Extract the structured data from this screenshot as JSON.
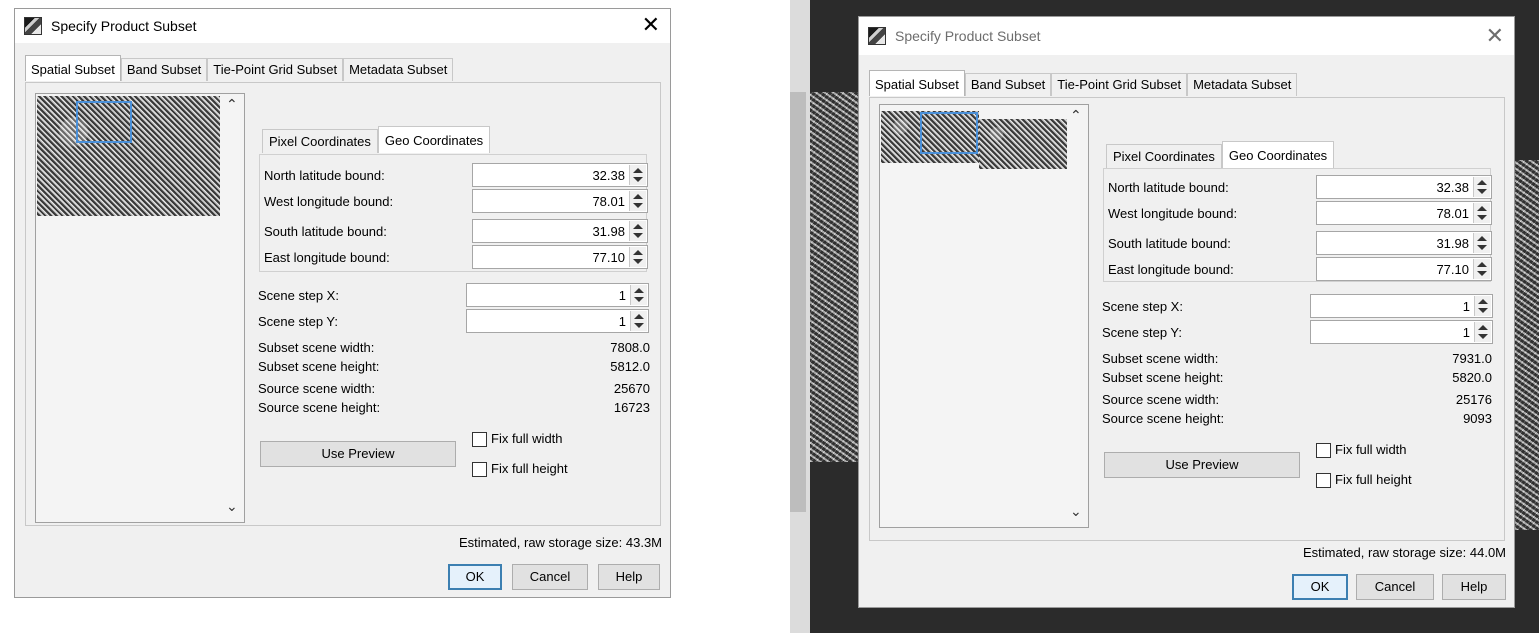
{
  "dialogs": [
    {
      "title": "Specify Product Subset",
      "close_glyph": "✕",
      "tabs": [
        "Spatial Subset",
        "Band Subset",
        "Tie-Point Grid Subset",
        "Metadata Subset"
      ],
      "subtabs": [
        "Pixel Coordinates",
        "Geo Coordinates"
      ],
      "fields": [
        {
          "label": "North latitude bound:",
          "value": "32.38"
        },
        {
          "label": "West longitude bound:",
          "value": "78.01"
        },
        {
          "label": "South latitude bound:",
          "value": "31.98"
        },
        {
          "label": "East longitude bound:",
          "value": "77.10"
        }
      ],
      "steps": [
        {
          "label": "Scene step X:",
          "value": "1"
        },
        {
          "label": "Scene step Y:",
          "value": "1"
        }
      ],
      "info": [
        {
          "label": "Subset scene width:",
          "value": "7808.0"
        },
        {
          "label": "Subset scene height:",
          "value": "5812.0"
        },
        {
          "label": "Source scene width:",
          "value": "25670"
        },
        {
          "label": "Source scene height:",
          "value": "16723"
        }
      ],
      "use_preview": "Use Preview",
      "fix_full_width": "Fix full width",
      "fix_full_height": "Fix full height",
      "storage": "Estimated, raw storage size: 43.3M",
      "ok": "OK",
      "cancel": "Cancel",
      "help": "Help"
    },
    {
      "title": "Specify Product Subset",
      "close_glyph": "✕",
      "tabs": [
        "Spatial Subset",
        "Band Subset",
        "Tie-Point Grid Subset",
        "Metadata Subset"
      ],
      "subtabs": [
        "Pixel Coordinates",
        "Geo Coordinates"
      ],
      "fields": [
        {
          "label": "North latitude bound:",
          "value": "32.38"
        },
        {
          "label": "West longitude bound:",
          "value": "78.01"
        },
        {
          "label": "South latitude bound:",
          "value": "31.98"
        },
        {
          "label": "East longitude bound:",
          "value": "77.10"
        }
      ],
      "steps": [
        {
          "label": "Scene step X:",
          "value": "1"
        },
        {
          "label": "Scene step Y:",
          "value": "1"
        }
      ],
      "info": [
        {
          "label": "Subset scene width:",
          "value": "7931.0"
        },
        {
          "label": "Subset scene height:",
          "value": "5820.0"
        },
        {
          "label": "Source scene width:",
          "value": "25176"
        },
        {
          "label": "Source scene height:",
          "value": "9093"
        }
      ],
      "use_preview": "Use Preview",
      "fix_full_width": "Fix full width",
      "fix_full_height": "Fix full height",
      "storage": "Estimated, raw storage size: 44.0M",
      "ok": "OK",
      "cancel": "Cancel",
      "help": "Help"
    }
  ],
  "icons": {
    "app": "app-icon",
    "close": "close-icon",
    "scroll_up": "chevron-up-icon",
    "scroll_down": "chevron-down-icon",
    "spinner": "spinner-arrows-icon",
    "scroll_up_glyph": "⌃",
    "scroll_down_glyph": "⌄"
  },
  "colors": {
    "dialog_bg": "#f0f0f0",
    "selection_rect": "#4a90d9",
    "primary_border": "#3c7fb1",
    "right_background": "#2b2b2b"
  }
}
